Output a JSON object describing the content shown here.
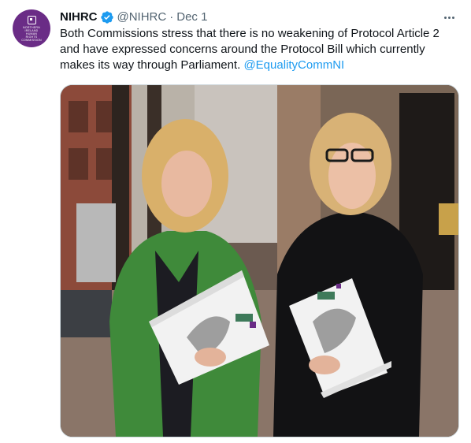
{
  "tweet": {
    "author": {
      "display_name": "NIHRC",
      "handle": "@NIHRC",
      "verified": true,
      "avatar_text": [
        "NORTHERN",
        "IRELAND",
        "HUMAN",
        "RIGHTS",
        "COMMISSION"
      ],
      "avatar_color": "#6a2c86"
    },
    "separator": "·",
    "date": "Dec 1",
    "text_lines": [
      "Both Commissions stress that there is no weakening of Protocol Article 2",
      "and have expressed concerns around the Protocol Bill which currently",
      "makes its way through Parliament."
    ],
    "mention": "@EqualityCommNI",
    "media": {
      "description_icon": "photo-two-commissioners-holding-reports"
    }
  },
  "colors": {
    "link": "#1d9bf0",
    "secondary_text": "#536471",
    "primary_text": "#0f1419",
    "verified": "#1d9bf0"
  }
}
